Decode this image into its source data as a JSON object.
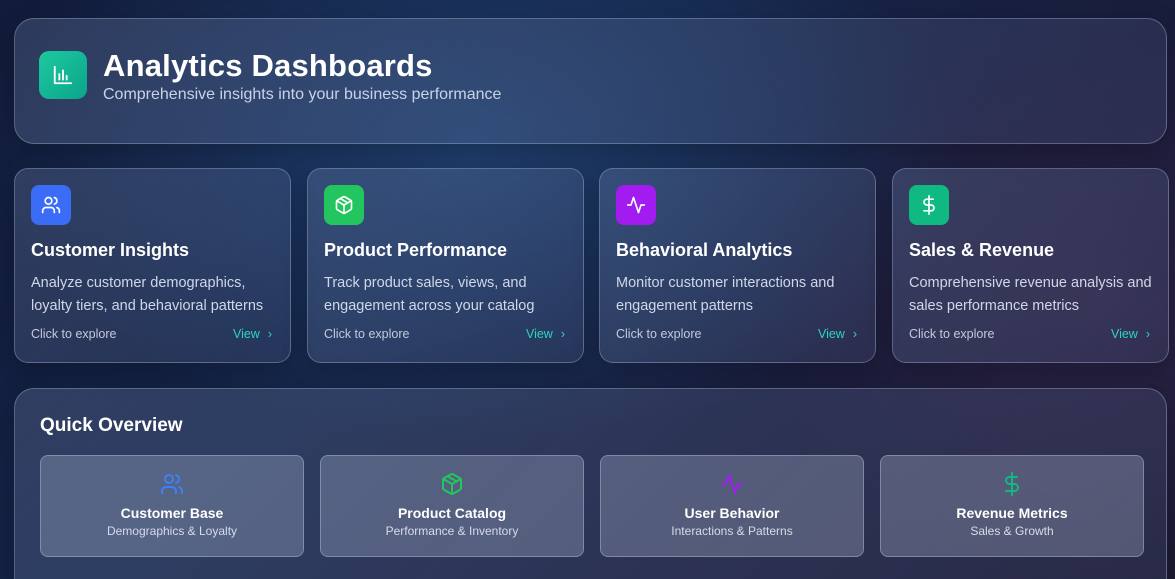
{
  "header": {
    "icon": "bar-chart-icon",
    "title": "Analytics Dashboards",
    "subtitle": "Comprehensive insights into your business performance",
    "icon_color": "#14b8a6"
  },
  "cards": [
    {
      "icon": "users-icon",
      "icon_color": "#3b6cf6",
      "title": "Customer Insights",
      "description": "Analyze customer demographics, loyalty tiers, and behavioral patterns",
      "cta": "Click to explore",
      "view_label": "View"
    },
    {
      "icon": "box-icon",
      "icon_color": "#22c55e",
      "title": "Product Performance",
      "description": "Track product sales, views, and engagement across your catalog",
      "cta": "Click to explore",
      "view_label": "View"
    },
    {
      "icon": "activity-icon",
      "icon_color": "#a21cf0",
      "title": "Behavioral Analytics",
      "description": "Monitor customer interactions and engagement patterns",
      "cta": "Click to explore",
      "view_label": "View"
    },
    {
      "icon": "dollar-icon",
      "icon_color": "#10b981",
      "title": "Sales & Revenue",
      "description": "Comprehensive revenue analysis and sales performance metrics",
      "cta": "Click to explore",
      "view_label": "View"
    }
  ],
  "overview": {
    "title": "Quick Overview",
    "tiles": [
      {
        "icon": "users-icon",
        "icon_color": "#3b82f6",
        "title": "Customer Base",
        "subtitle": "Demographics & Loyalty"
      },
      {
        "icon": "box-icon",
        "icon_color": "#22c55e",
        "title": "Product Catalog",
        "subtitle": "Performance & Inventory"
      },
      {
        "icon": "activity-icon",
        "icon_color": "#a21cf0",
        "title": "User Behavior",
        "subtitle": "Interactions & Patterns"
      },
      {
        "icon": "dollar-icon",
        "icon_color": "#10b981",
        "title": "Revenue Metrics",
        "subtitle": "Sales & Growth"
      }
    ]
  },
  "colors": {
    "accent": "#2dd4bf"
  }
}
